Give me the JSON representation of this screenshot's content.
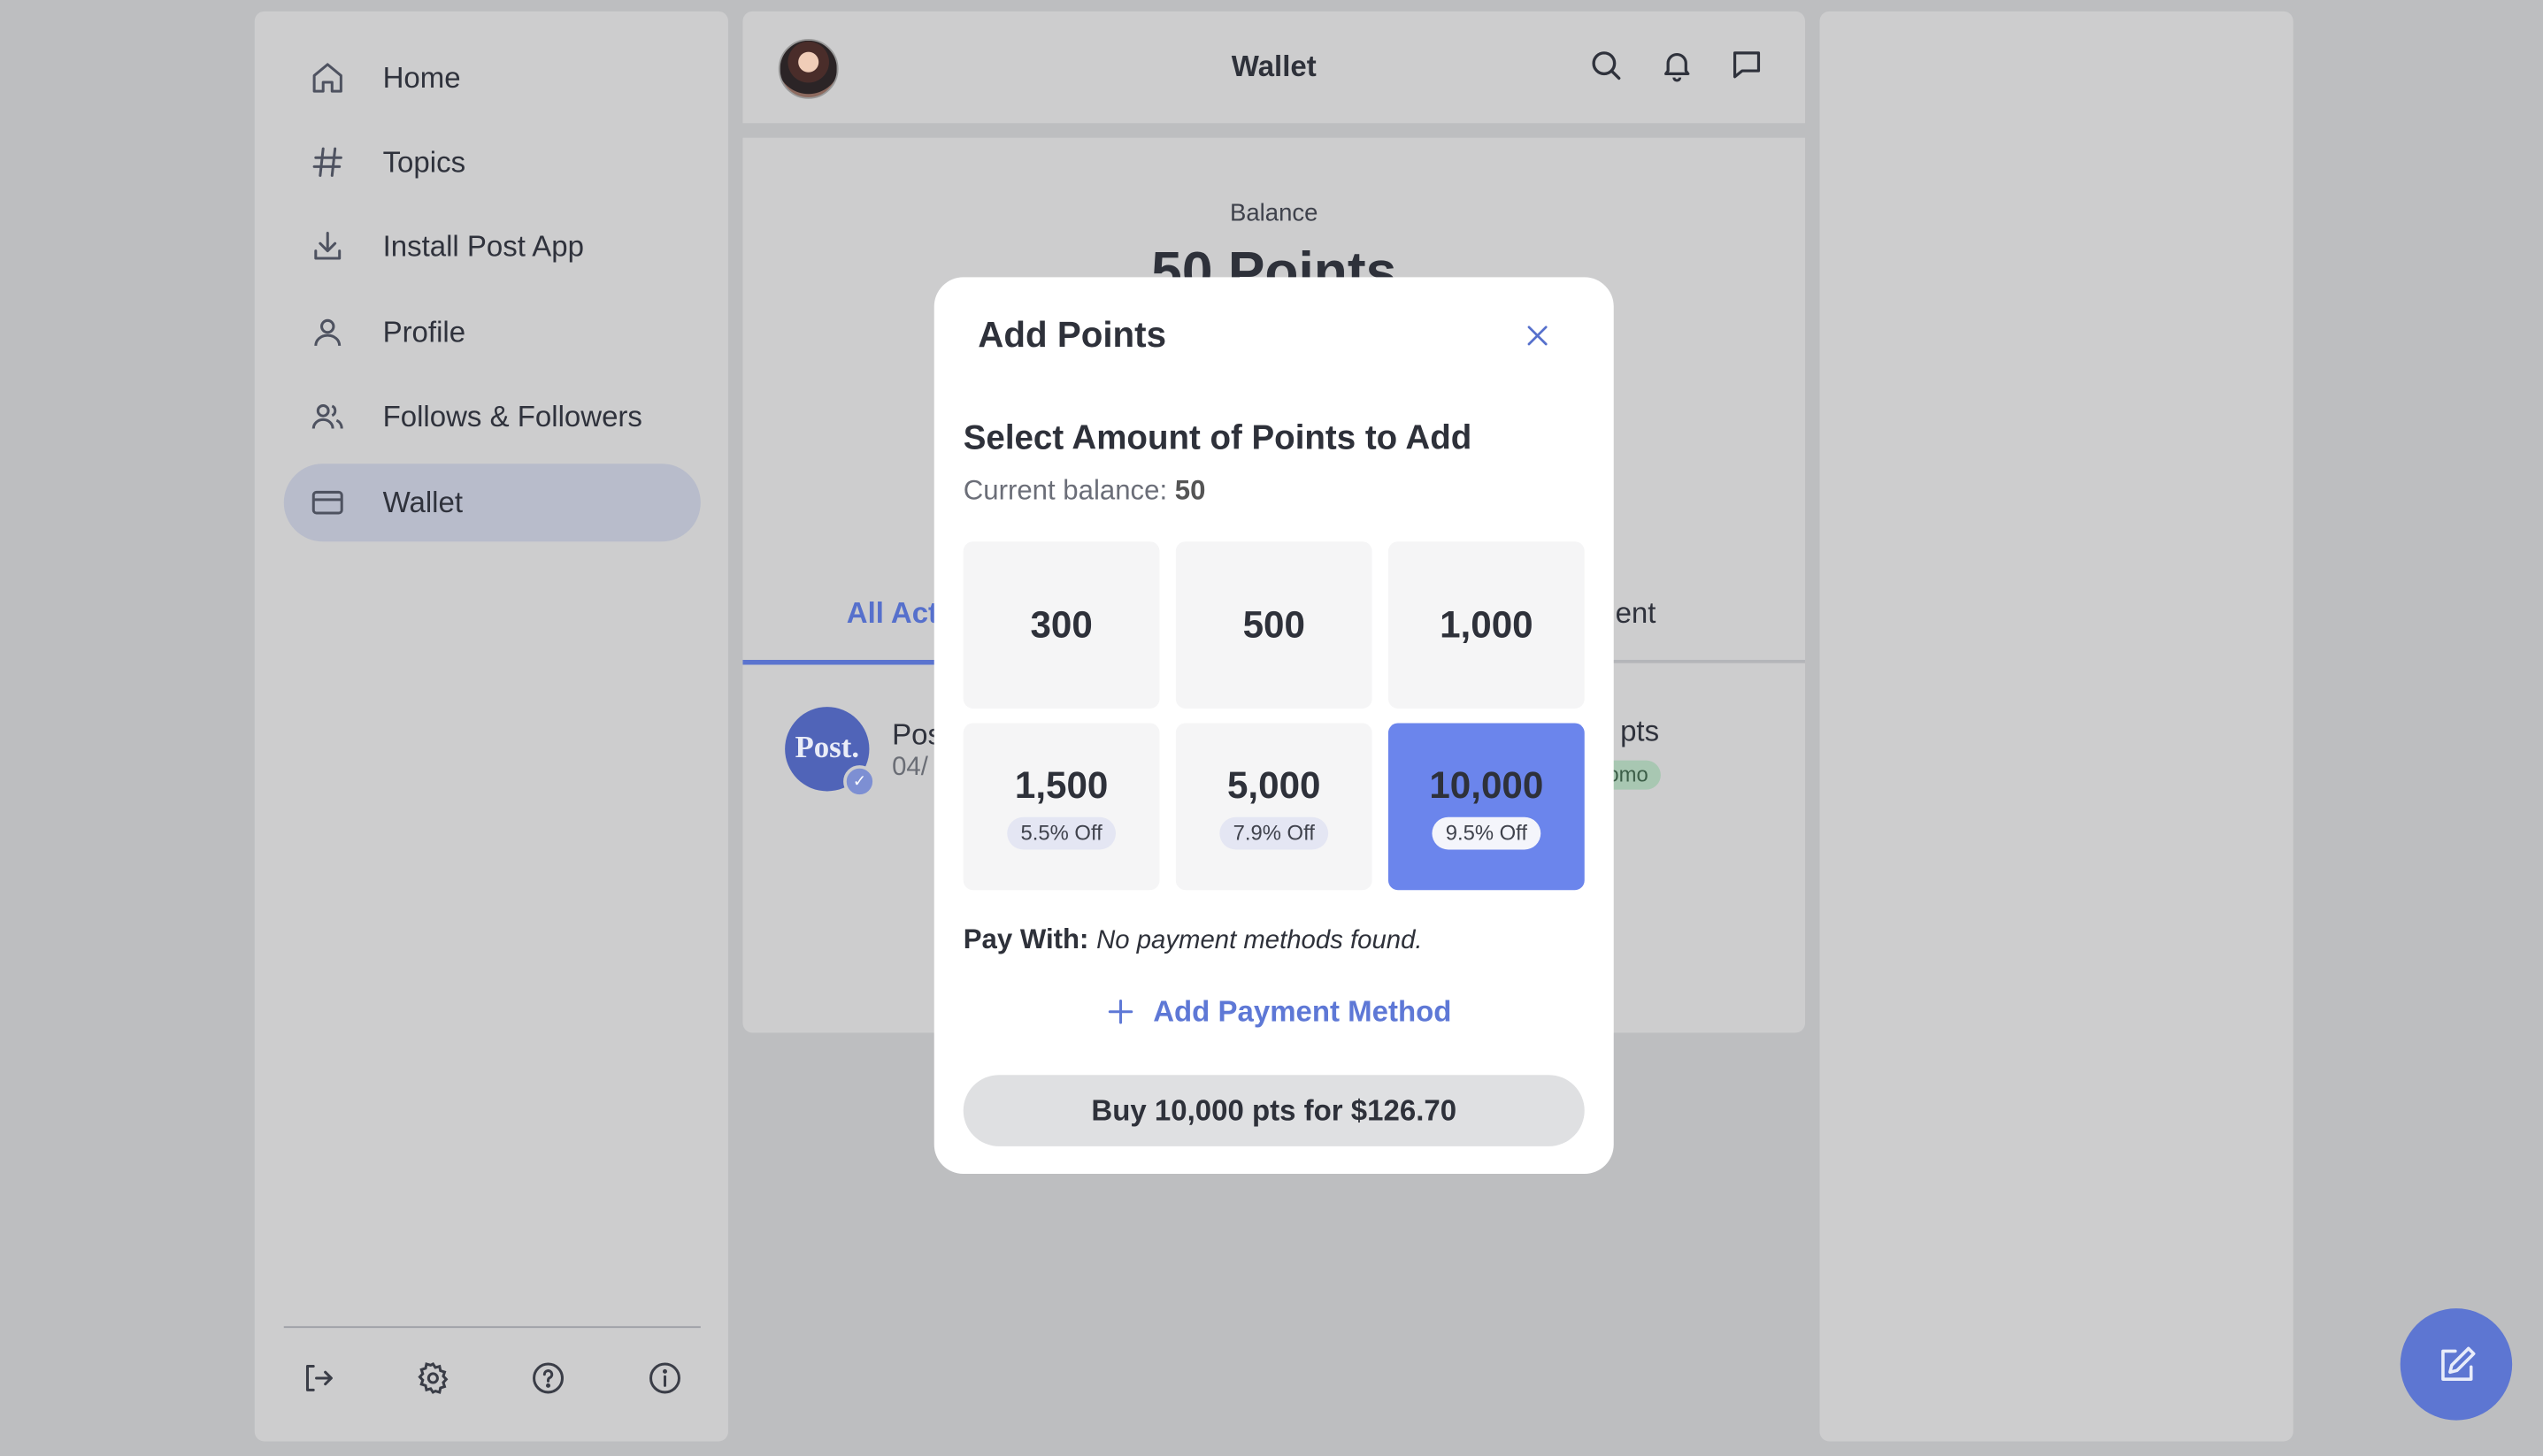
{
  "sidebar": {
    "items": [
      {
        "label": "Home",
        "icon": "home-icon"
      },
      {
        "label": "Topics",
        "icon": "hash-icon"
      },
      {
        "label": "Install Post App",
        "icon": "download-icon"
      },
      {
        "label": "Profile",
        "icon": "user-icon"
      },
      {
        "label": "Follows & Followers",
        "icon": "users-icon"
      },
      {
        "label": "Wallet",
        "icon": "credit-card-icon",
        "active": true
      }
    ],
    "footer_icons": [
      "logout-icon",
      "settings-gear-icon",
      "help-icon",
      "info-icon"
    ]
  },
  "header": {
    "title": "Wallet",
    "icons": [
      "search-icon",
      "bell-icon",
      "message-icon"
    ]
  },
  "wallet": {
    "balance_label": "Balance",
    "balance_value": "50 Points",
    "tab_all": "All Act",
    "tab_right": "ent",
    "row": {
      "title": "Pos",
      "date": "04/",
      "pts": "pts",
      "badge": "omo",
      "logo_text": "Post."
    }
  },
  "modal": {
    "title": "Add Points",
    "heading": "Select Amount of Points to Add",
    "current_balance_label": "Current balance:",
    "current_balance_value": "50",
    "options": [
      {
        "amount": "300",
        "discount": ""
      },
      {
        "amount": "500",
        "discount": ""
      },
      {
        "amount": "1,000",
        "discount": ""
      },
      {
        "amount": "1,500",
        "discount": "5.5% Off"
      },
      {
        "amount": "5,000",
        "discount": "7.9% Off"
      },
      {
        "amount": "10,000",
        "discount": "9.5% Off",
        "selected": true
      }
    ],
    "pay_with_label": "Pay With:",
    "pay_with_value": "No payment methods found.",
    "add_payment_label": "Add Payment Method",
    "buy_label": "Buy 10,000 pts for $126.70"
  },
  "colors": {
    "accent": "#5670cc",
    "selected_option": "#6b85ec",
    "fab": "#5d76d2",
    "overlay_bg": "#bdbec0"
  }
}
